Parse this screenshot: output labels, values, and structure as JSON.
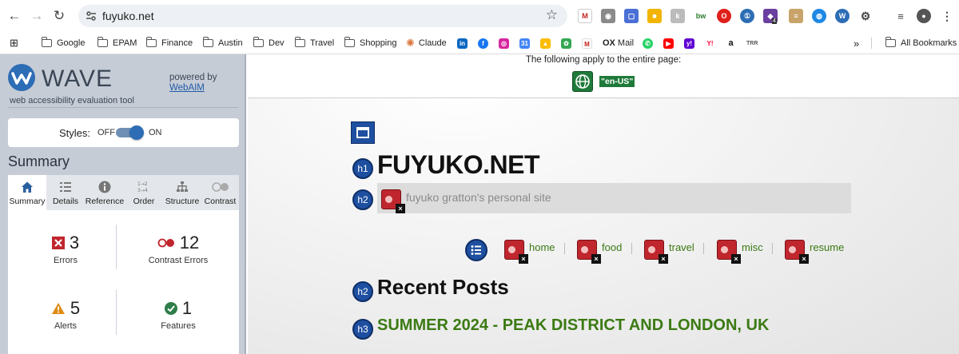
{
  "browser": {
    "url": "fuyuko.net",
    "bookmarks": [
      "Google",
      "EPAM",
      "Finance",
      "Austin",
      "Dev",
      "Travel",
      "Shopping",
      "Claude"
    ],
    "bookmark_mail": "Mail",
    "all_bookmarks": "All Bookmarks",
    "ext_badge": "4"
  },
  "wave": {
    "logo": "WAVE",
    "tagline": "web accessibility evaluation tool",
    "powered_by": "powered by",
    "webaim": "WebAIM",
    "styles_label": "Styles:",
    "styles_off": "OFF",
    "styles_on": "ON",
    "styles_state": "on",
    "summary_title": "Summary",
    "tabs": [
      {
        "label": "Summary",
        "icon": "home-icon"
      },
      {
        "label": "Details",
        "icon": "list-icon"
      },
      {
        "label": "Reference",
        "icon": "info-icon"
      },
      {
        "label": "Order",
        "icon": "order-icon"
      },
      {
        "label": "Structure",
        "icon": "structure-icon"
      },
      {
        "label": "Contrast",
        "icon": "contrast-icon"
      }
    ],
    "counts": {
      "errors": {
        "value": "3",
        "label": "Errors"
      },
      "contrast": {
        "value": "12",
        "label": "Contrast Errors"
      },
      "alerts": {
        "value": "5",
        "label": "Alerts"
      },
      "features": {
        "value": "1",
        "label": "Features"
      }
    }
  },
  "page": {
    "applies_text": "The following apply to the entire page:",
    "lang": "\"en-US\"",
    "site_title": "FUYUKO.NET",
    "h1": "h1",
    "h2": "h2",
    "h3": "h3",
    "subtitle": "fuyuko gratton's personal site",
    "nav": [
      "home",
      "food",
      "travel",
      "misc",
      "resume"
    ],
    "recent_posts": "Recent Posts",
    "post_title": "SUMMER 2024 - PEAK DISTRICT AND LONDON, UK"
  },
  "colors": {
    "wave_blue": "#2d6db5",
    "link_green": "#3b7a13",
    "error_red": "#c0262d",
    "feature_green": "#1f7a3a"
  }
}
